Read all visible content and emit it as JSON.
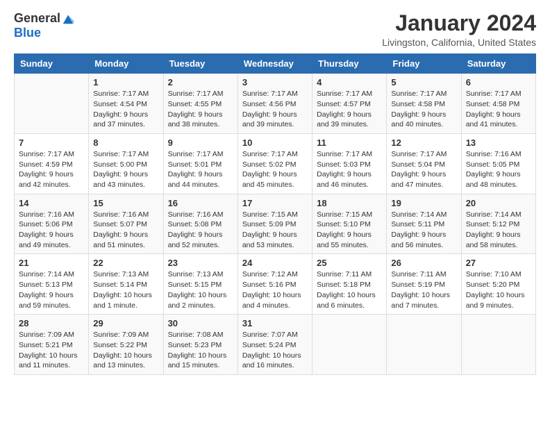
{
  "header": {
    "logo_general": "General",
    "logo_blue": "Blue",
    "title": "January 2024",
    "location": "Livingston, California, United States"
  },
  "days_of_week": [
    "Sunday",
    "Monday",
    "Tuesday",
    "Wednesday",
    "Thursday",
    "Friday",
    "Saturday"
  ],
  "weeks": [
    [
      {
        "day": "",
        "info": ""
      },
      {
        "day": "1",
        "info": "Sunrise: 7:17 AM\nSunset: 4:54 PM\nDaylight: 9 hours\nand 37 minutes."
      },
      {
        "day": "2",
        "info": "Sunrise: 7:17 AM\nSunset: 4:55 PM\nDaylight: 9 hours\nand 38 minutes."
      },
      {
        "day": "3",
        "info": "Sunrise: 7:17 AM\nSunset: 4:56 PM\nDaylight: 9 hours\nand 39 minutes."
      },
      {
        "day": "4",
        "info": "Sunrise: 7:17 AM\nSunset: 4:57 PM\nDaylight: 9 hours\nand 39 minutes."
      },
      {
        "day": "5",
        "info": "Sunrise: 7:17 AM\nSunset: 4:58 PM\nDaylight: 9 hours\nand 40 minutes."
      },
      {
        "day": "6",
        "info": "Sunrise: 7:17 AM\nSunset: 4:58 PM\nDaylight: 9 hours\nand 41 minutes."
      }
    ],
    [
      {
        "day": "7",
        "info": "Sunrise: 7:17 AM\nSunset: 4:59 PM\nDaylight: 9 hours\nand 42 minutes."
      },
      {
        "day": "8",
        "info": "Sunrise: 7:17 AM\nSunset: 5:00 PM\nDaylight: 9 hours\nand 43 minutes."
      },
      {
        "day": "9",
        "info": "Sunrise: 7:17 AM\nSunset: 5:01 PM\nDaylight: 9 hours\nand 44 minutes."
      },
      {
        "day": "10",
        "info": "Sunrise: 7:17 AM\nSunset: 5:02 PM\nDaylight: 9 hours\nand 45 minutes."
      },
      {
        "day": "11",
        "info": "Sunrise: 7:17 AM\nSunset: 5:03 PM\nDaylight: 9 hours\nand 46 minutes."
      },
      {
        "day": "12",
        "info": "Sunrise: 7:17 AM\nSunset: 5:04 PM\nDaylight: 9 hours\nand 47 minutes."
      },
      {
        "day": "13",
        "info": "Sunrise: 7:16 AM\nSunset: 5:05 PM\nDaylight: 9 hours\nand 48 minutes."
      }
    ],
    [
      {
        "day": "14",
        "info": "Sunrise: 7:16 AM\nSunset: 5:06 PM\nDaylight: 9 hours\nand 49 minutes."
      },
      {
        "day": "15",
        "info": "Sunrise: 7:16 AM\nSunset: 5:07 PM\nDaylight: 9 hours\nand 51 minutes."
      },
      {
        "day": "16",
        "info": "Sunrise: 7:16 AM\nSunset: 5:08 PM\nDaylight: 9 hours\nand 52 minutes."
      },
      {
        "day": "17",
        "info": "Sunrise: 7:15 AM\nSunset: 5:09 PM\nDaylight: 9 hours\nand 53 minutes."
      },
      {
        "day": "18",
        "info": "Sunrise: 7:15 AM\nSunset: 5:10 PM\nDaylight: 9 hours\nand 55 minutes."
      },
      {
        "day": "19",
        "info": "Sunrise: 7:14 AM\nSunset: 5:11 PM\nDaylight: 9 hours\nand 56 minutes."
      },
      {
        "day": "20",
        "info": "Sunrise: 7:14 AM\nSunset: 5:12 PM\nDaylight: 9 hours\nand 58 minutes."
      }
    ],
    [
      {
        "day": "21",
        "info": "Sunrise: 7:14 AM\nSunset: 5:13 PM\nDaylight: 9 hours\nand 59 minutes."
      },
      {
        "day": "22",
        "info": "Sunrise: 7:13 AM\nSunset: 5:14 PM\nDaylight: 10 hours\nand 1 minute."
      },
      {
        "day": "23",
        "info": "Sunrise: 7:13 AM\nSunset: 5:15 PM\nDaylight: 10 hours\nand 2 minutes."
      },
      {
        "day": "24",
        "info": "Sunrise: 7:12 AM\nSunset: 5:16 PM\nDaylight: 10 hours\nand 4 minutes."
      },
      {
        "day": "25",
        "info": "Sunrise: 7:11 AM\nSunset: 5:18 PM\nDaylight: 10 hours\nand 6 minutes."
      },
      {
        "day": "26",
        "info": "Sunrise: 7:11 AM\nSunset: 5:19 PM\nDaylight: 10 hours\nand 7 minutes."
      },
      {
        "day": "27",
        "info": "Sunrise: 7:10 AM\nSunset: 5:20 PM\nDaylight: 10 hours\nand 9 minutes."
      }
    ],
    [
      {
        "day": "28",
        "info": "Sunrise: 7:09 AM\nSunset: 5:21 PM\nDaylight: 10 hours\nand 11 minutes."
      },
      {
        "day": "29",
        "info": "Sunrise: 7:09 AM\nSunset: 5:22 PM\nDaylight: 10 hours\nand 13 minutes."
      },
      {
        "day": "30",
        "info": "Sunrise: 7:08 AM\nSunset: 5:23 PM\nDaylight: 10 hours\nand 15 minutes."
      },
      {
        "day": "31",
        "info": "Sunrise: 7:07 AM\nSunset: 5:24 PM\nDaylight: 10 hours\nand 16 minutes."
      },
      {
        "day": "",
        "info": ""
      },
      {
        "day": "",
        "info": ""
      },
      {
        "day": "",
        "info": ""
      }
    ]
  ]
}
